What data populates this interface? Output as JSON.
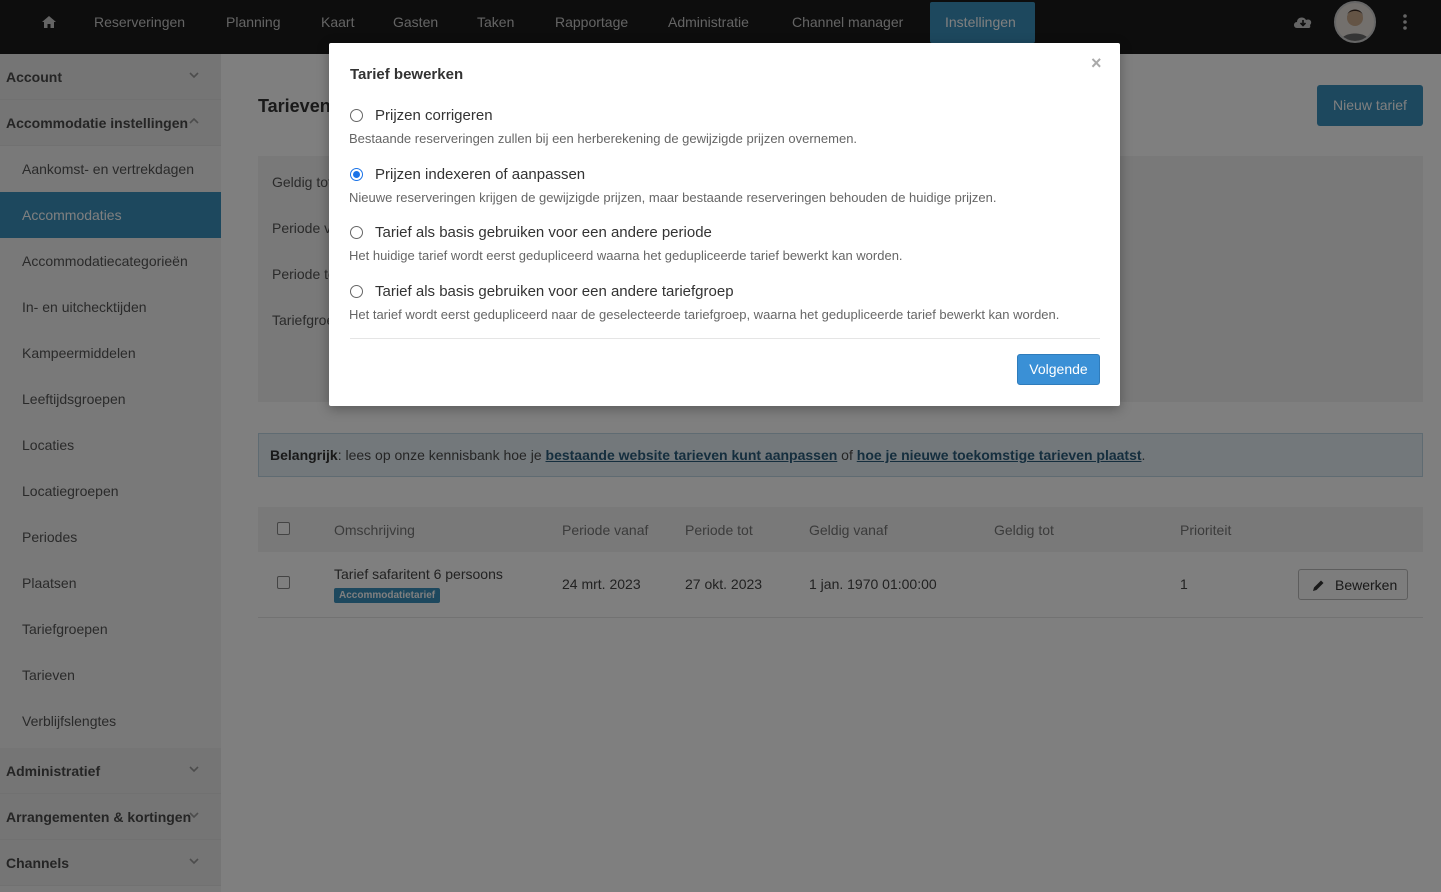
{
  "nav": {
    "items": [
      {
        "label": "Reserveringen"
      },
      {
        "label": "Planning"
      },
      {
        "label": "Kaart"
      },
      {
        "label": "Gasten"
      },
      {
        "label": "Taken"
      },
      {
        "label": "Rapportage"
      },
      {
        "label": "Administratie"
      },
      {
        "label": "Channel manager"
      },
      {
        "label": "Instellingen",
        "active": true
      }
    ],
    "icons": [
      "home-icon",
      "cloud-download-icon",
      "kebab-menu-icon"
    ]
  },
  "sidebar": {
    "groups": [
      {
        "label": "Account"
      },
      {
        "label": "Accommodatie instellingen"
      },
      {
        "label": "Administratief"
      },
      {
        "label": "Arrangementen & kortingen"
      },
      {
        "label": "Channels"
      }
    ],
    "items": [
      {
        "label": "Aankomst- en vertrekdagen"
      },
      {
        "label": "Accommodaties",
        "active": true
      },
      {
        "label": "Accommodatiecategorieën"
      },
      {
        "label": "In- en uitchecktijden"
      },
      {
        "label": "Kampeermiddelen"
      },
      {
        "label": "Leeftijdsgroepen"
      },
      {
        "label": "Locaties"
      },
      {
        "label": "Locatiegroepen"
      },
      {
        "label": "Periodes"
      },
      {
        "label": "Plaatsen"
      },
      {
        "label": "Tariefgroepen"
      },
      {
        "label": "Tarieven"
      },
      {
        "label": "Verblijfslengtes"
      }
    ]
  },
  "main": {
    "title": "Tarieven",
    "new_button": "Nieuw tarief",
    "filters": [
      "Geldig tot",
      "Periode v",
      "Periode to",
      "Tariefgroe"
    ],
    "info": {
      "strong": "Belangrijk",
      "text1": ": lees op onze kennisbank hoe je ",
      "link1": "bestaande website tarieven kunt aanpassen",
      "text2": " of ",
      "link2": "hoe je nieuwe toekomstige tarieven plaatst",
      "text3": "."
    },
    "table": {
      "headers": [
        "Omschrijving",
        "Periode vanaf",
        "Periode tot",
        "Geldig vanaf",
        "Geldig tot",
        "Prioriteit"
      ],
      "rows": [
        {
          "omschrijving": "Tarief safaritent 6 persoons",
          "badge": "Accommodatietarief",
          "periode_vanaf": "24 mrt. 2023",
          "periode_tot": "27 okt. 2023",
          "geldig_vanaf": "1 jan. 1970 01:00:00",
          "geldig_tot": "",
          "prioriteit": "1",
          "edit_label": "Bewerken"
        }
      ]
    }
  },
  "modal": {
    "title": "Tarief bewerken",
    "close": "×",
    "options": [
      {
        "title": "Prijzen corrigeren",
        "desc": "Bestaande reserveringen zullen bij een herberekening de gewijzigde prijzen overnemen.",
        "checked": false
      },
      {
        "title": "Prijzen indexeren of aanpassen",
        "desc": "Nieuwe reserveringen krijgen de gewijzigde prijzen, maar bestaande reserveringen behouden de huidige prijzen.",
        "checked": true
      },
      {
        "title": "Tarief als basis gebruiken voor een andere periode",
        "desc": "Het huidige tarief wordt eerst gedupliceerd waarna het gedupliceerde tarief bewerkt kan worden.",
        "checked": false
      },
      {
        "title": "Tarief als basis gebruiken voor een andere tariefgroep",
        "desc": "Het tarief wordt eerst gedupliceerd naar de geselecteerde tariefgroep, waarna het gedupliceerde tarief bewerkt kan worden.",
        "checked": false
      }
    ],
    "next_button": "Volgende"
  }
}
